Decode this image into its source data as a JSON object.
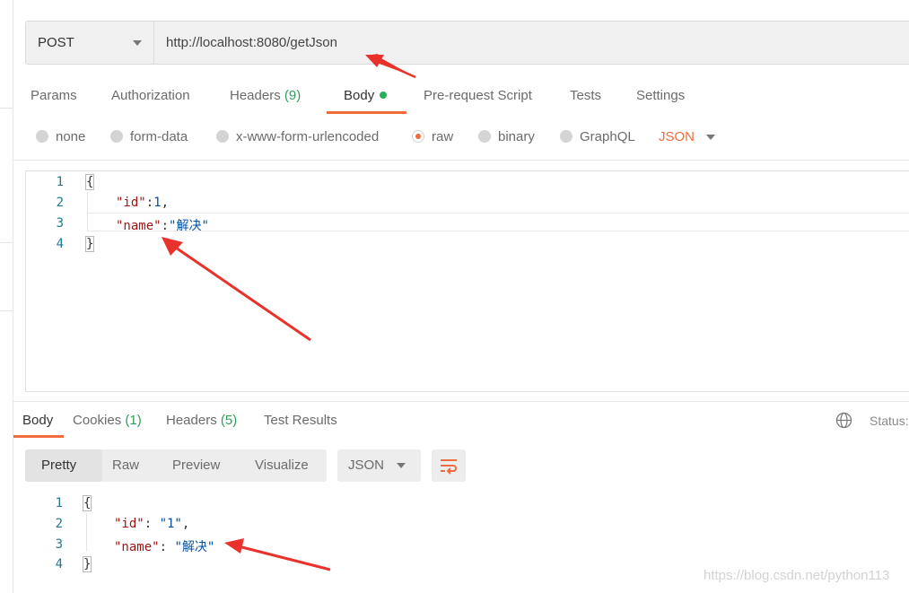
{
  "request": {
    "method": "POST",
    "url": "http://localhost:8080/getJson"
  },
  "request_tabs": [
    {
      "label": "Params"
    },
    {
      "label": "Authorization"
    },
    {
      "label": "Headers",
      "count": "(9)"
    },
    {
      "label": "Body"
    },
    {
      "label": "Pre-request Script"
    },
    {
      "label": "Tests"
    },
    {
      "label": "Settings"
    }
  ],
  "body_types": [
    {
      "label": "none",
      "selected": false
    },
    {
      "label": "form-data",
      "selected": false
    },
    {
      "label": "x-www-form-urlencoded",
      "selected": false
    },
    {
      "label": "raw",
      "selected": true
    },
    {
      "label": "binary",
      "selected": false
    },
    {
      "label": "GraphQL",
      "selected": false
    }
  ],
  "raw_format": "JSON",
  "request_body": {
    "line_numbers": [
      "1",
      "2",
      "3",
      "4"
    ],
    "open": "{",
    "id_key": "\"id\"",
    "id_colon": ":",
    "id_value": "1",
    "id_comma": ",",
    "name_key": "\"name\"",
    "name_colon": ":",
    "name_value": "\"解决\"",
    "close": "}"
  },
  "response_tabs": [
    {
      "label": "Body"
    },
    {
      "label": "Cookies",
      "count": "(1)"
    },
    {
      "label": "Headers",
      "count": "(5)"
    },
    {
      "label": "Test Results"
    }
  ],
  "status_label": "Status:",
  "view_modes": [
    "Pretty",
    "Raw",
    "Preview",
    "Visualize"
  ],
  "response_format": "JSON",
  "response_body": {
    "line_numbers": [
      "1",
      "2",
      "3",
      "4"
    ],
    "open": "{",
    "id_key": "\"id\"",
    "id_colon": ": ",
    "id_value": "\"1\"",
    "id_comma": ",",
    "name_key": "\"name\"",
    "name_colon": ": ",
    "name_value": "\"解决\"",
    "close": "}"
  },
  "watermark": "https://blog.csdn.net/python113",
  "colors": {
    "accent": "#f26b3a",
    "count_green": "#2e9e58",
    "annotation_red": "#e8322b",
    "json_key": "#a31515",
    "json_value": "#0451a5"
  },
  "icons": [
    "chevron-down-icon",
    "globe-icon",
    "wrap-lines-icon",
    "annotation-arrow"
  ]
}
